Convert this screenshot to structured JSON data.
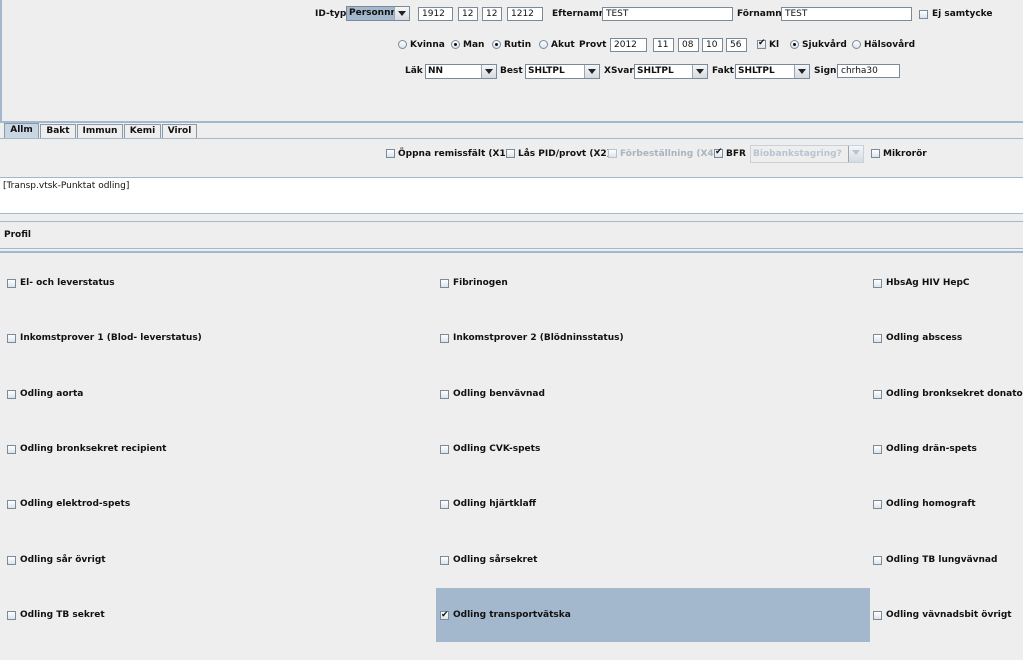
{
  "header": {
    "idtyp_label": "ID-typ",
    "idtyp_value": "Personnr",
    "pnr_year": "1912",
    "pnr_month": "12",
    "pnr_day": "12",
    "pnr_last": "1212",
    "efternamn_label": "Efternamn",
    "efternamn_value": "TEST",
    "fornamn_label": "Förnamn",
    "fornamn_value": "TEST",
    "ej_samtycke": "Ej samtycke",
    "kvinna": "Kvinna",
    "man": "Man",
    "rutin": "Rutin",
    "akut": "Akut",
    "provt_label": "Provt",
    "provt_year": "2012",
    "provt_month": "11",
    "provt_day": "08",
    "provt_hour": "10",
    "provt_min": "56",
    "kl": "Kl",
    "sjukvard": "Sjukvård",
    "halsovard": "Hälsovård",
    "lak_label": "Läk",
    "lak_value": "NN",
    "best_label": "Best",
    "best_value": "SHLTPL",
    "xsvar_label": "XSvar",
    "xsvar_value": "SHLTPL",
    "fakt_label": "Fakt",
    "fakt_value": "SHLTPL",
    "sign_label": "Sign",
    "sign_value": "chrha30"
  },
  "tabs": [
    "Allm",
    "Bakt",
    "Immun",
    "Kemi",
    "Virol"
  ],
  "options": {
    "oppna": "Öppna remissfält (X1)",
    "las": "Lås PID/provt (X2)",
    "forbestallning": "Förbeställning (X4)",
    "bfr": "BFR",
    "biobank_placeholder": "Biobankstagring?",
    "mikroror": "Mikrorör"
  },
  "remiss_text": "[Transp.vtsk-Punktat odling]",
  "profil_label": "Profil",
  "profiles": [
    {
      "label": "El- och leverstatus",
      "checked": false
    },
    {
      "label": "Fibrinogen",
      "checked": false
    },
    {
      "label": "HbsAg HIV HepC",
      "checked": false
    },
    {
      "label": "Inkomstprover 1 (Blod- leverstatus)",
      "checked": false
    },
    {
      "label": "Inkomstprover 2 (Blödninsstatus)",
      "checked": false
    },
    {
      "label": "Odling abscess",
      "checked": false
    },
    {
      "label": "Odling aorta",
      "checked": false
    },
    {
      "label": "Odling benvävnad",
      "checked": false
    },
    {
      "label": "Odling bronksekret donator",
      "checked": false
    },
    {
      "label": "Odling bronksekret recipient",
      "checked": false
    },
    {
      "label": "Odling CVK-spets",
      "checked": false
    },
    {
      "label": "Odling drän-spets",
      "checked": false
    },
    {
      "label": "Odling elektrod-spets",
      "checked": false
    },
    {
      "label": "Odling hjärtklaff",
      "checked": false
    },
    {
      "label": "Odling homograft",
      "checked": false
    },
    {
      "label": "Odling sår övrigt",
      "checked": false
    },
    {
      "label": "Odling sårsekret",
      "checked": false
    },
    {
      "label": "Odling TB lungvävnad",
      "checked": false
    },
    {
      "label": "Odling TB sekret",
      "checked": false
    },
    {
      "label": "Odling transportvätska",
      "checked": true
    },
    {
      "label": "Odling vävnadsbit övrigt",
      "checked": false
    }
  ]
}
